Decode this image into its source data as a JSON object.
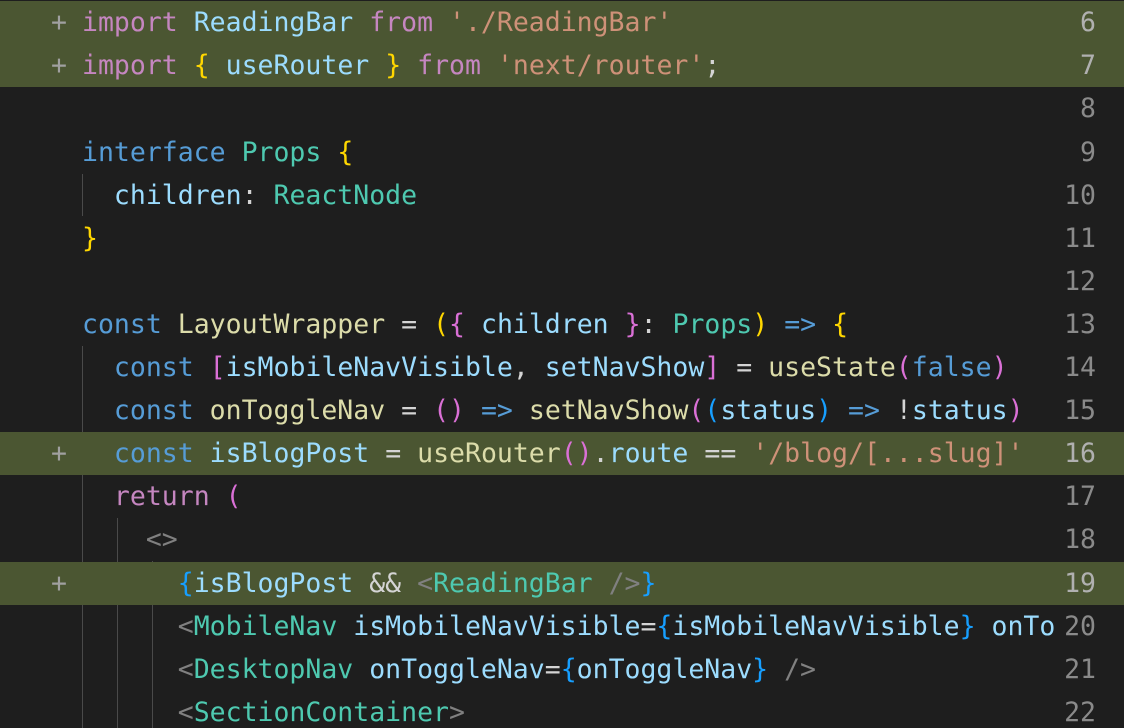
{
  "lines": [
    {
      "num": "6",
      "marker": "+",
      "added": true
    },
    {
      "num": "7",
      "marker": "+",
      "added": true
    },
    {
      "num": "8",
      "marker": "",
      "added": false
    },
    {
      "num": "9",
      "marker": "",
      "added": false
    },
    {
      "num": "10",
      "marker": "",
      "added": false
    },
    {
      "num": "11",
      "marker": "",
      "added": false
    },
    {
      "num": "12",
      "marker": "",
      "added": false
    },
    {
      "num": "13",
      "marker": "",
      "added": false
    },
    {
      "num": "14",
      "marker": "",
      "added": false
    },
    {
      "num": "15",
      "marker": "",
      "added": false
    },
    {
      "num": "16",
      "marker": "+",
      "added": true
    },
    {
      "num": "17",
      "marker": "",
      "added": false
    },
    {
      "num": "18",
      "marker": "",
      "added": false
    },
    {
      "num": "19",
      "marker": "+",
      "added": true
    },
    {
      "num": "20",
      "marker": "",
      "added": false
    },
    {
      "num": "21",
      "marker": "",
      "added": false
    },
    {
      "num": "22",
      "marker": "",
      "added": false
    }
  ],
  "tokens": {
    "import": "import",
    "from": "from",
    "interface": "interface",
    "const": "const",
    "return": "return",
    "false": "false",
    "ReadingBar": "ReadingBar",
    "readingbar_path": "'./ReadingBar'",
    "useRouter": "useRouter",
    "next_router": "'next/router'",
    "Props": "Props",
    "children": "children",
    "ReactNode": "ReactNode",
    "LayoutWrapper": "LayoutWrapper",
    "isMobileNavVisible": "isMobileNavVisible",
    "setNavShow": "setNavShow",
    "useState": "useState",
    "onToggleNav": "onToggleNav",
    "status": "status",
    "isBlogPost": "isBlogPost",
    "route": "route",
    "blog_slug": "'/blog/[...slug]'",
    "MobileNav": "MobileNav",
    "onTo": "onTo",
    "DesktopNav": "DesktopNav",
    "SectionContainer": "SectionContainer"
  },
  "colors": {
    "background": "#1e1e1e",
    "added_line": "#4b5632",
    "keyword_purple": "#c586c0",
    "keyword_blue": "#569cd6",
    "type": "#4ec9b0",
    "function": "#dcdcaa",
    "variable": "#9cdcfe",
    "string": "#ce9178"
  }
}
